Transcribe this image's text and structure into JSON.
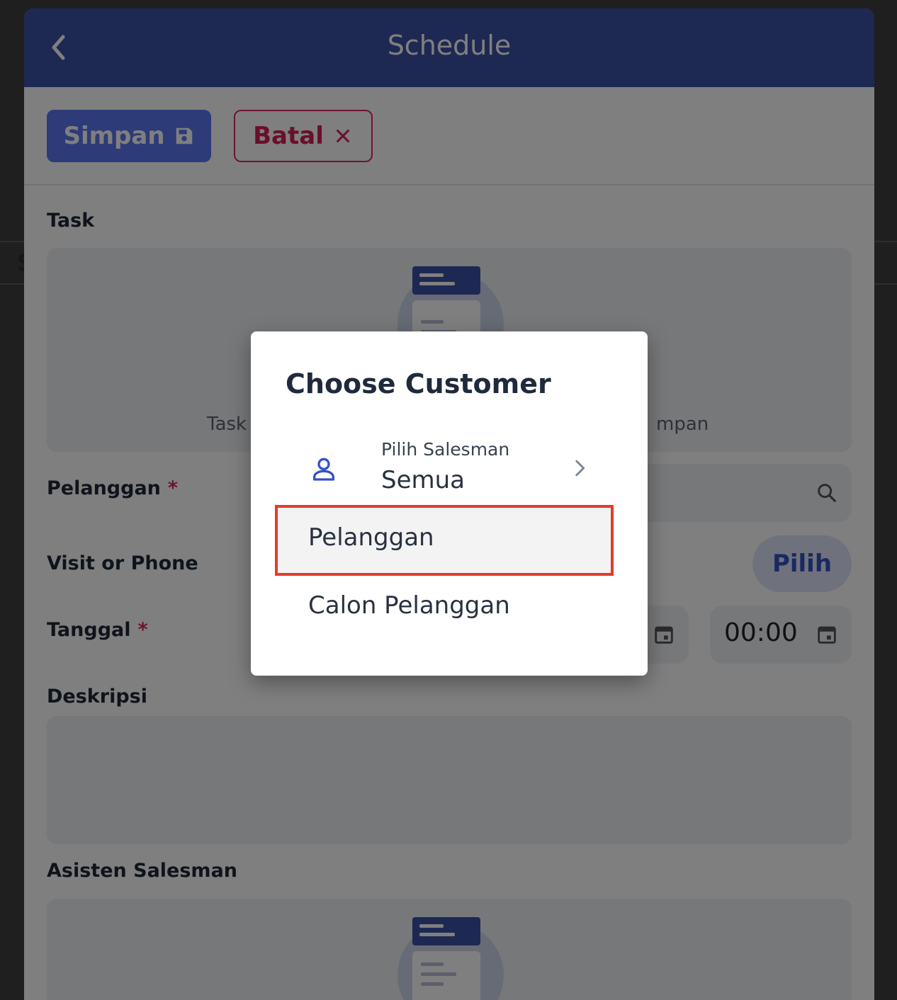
{
  "appbar": {
    "title": "Schedule"
  },
  "toolbar": {
    "save_label": "Simpan",
    "cancel_label": "Batal"
  },
  "form": {
    "task_label": "Task",
    "task_empty_left": "Task",
    "task_empty_right": "mpan",
    "customer_label": "Pelanggan",
    "required_mark": "*",
    "visit_label": "Visit or Phone",
    "pick_button": "Pilih",
    "date_label": "Tanggal",
    "time_value": "00:00",
    "description_label": "Deskripsi",
    "assistant_label": "Asisten Salesman"
  },
  "dialog": {
    "title": "Choose Customer",
    "salesman_label": "Pilih Salesman",
    "salesman_value": "Semua",
    "options": [
      "Pelanggan",
      "Calon Pelanggan"
    ],
    "selected_option": "Pelanggan"
  },
  "colors": {
    "appbar": "#3b53a6",
    "primary_button": "#5a76f0",
    "cancel_accent": "#d41e55",
    "highlight_border": "#e43b2a"
  },
  "icons": [
    "back-arrow-icon",
    "save-icon",
    "close-icon",
    "person-icon",
    "chevron-right-icon",
    "search-icon",
    "calendar-icon"
  ]
}
